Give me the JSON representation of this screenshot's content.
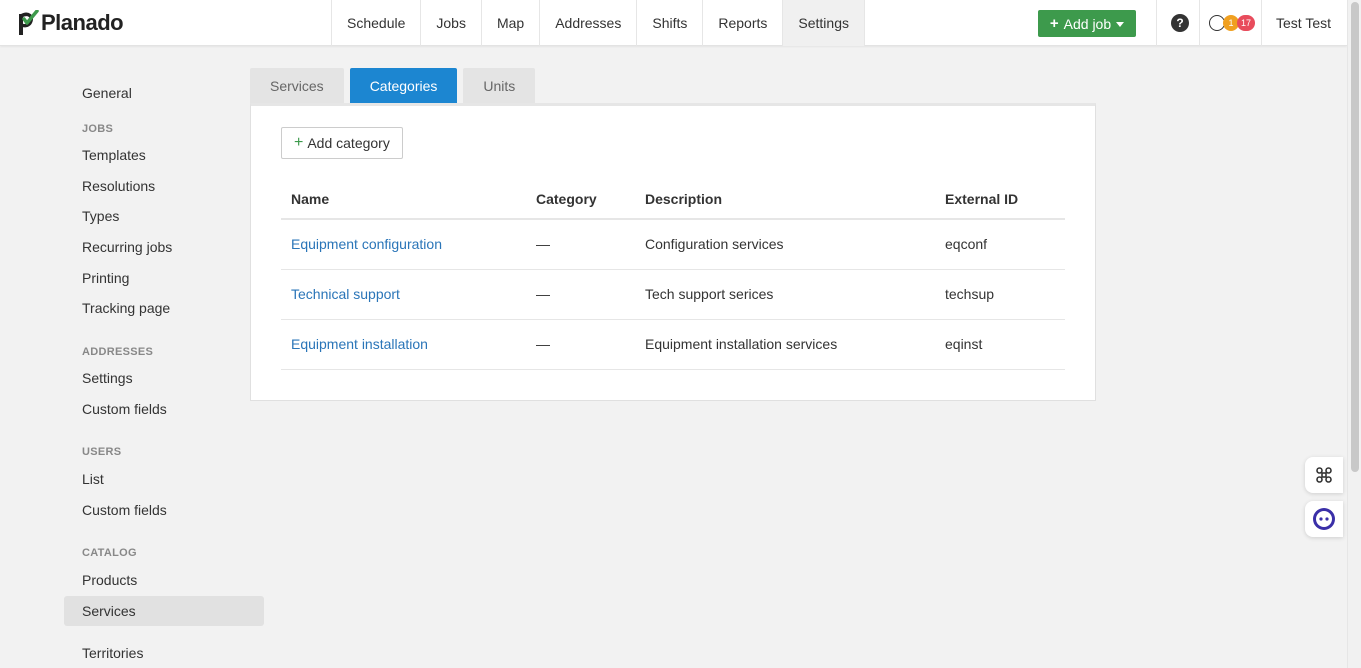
{
  "app": {
    "logo_text": "Planado",
    "brand_color": "#3d9a4c"
  },
  "nav": {
    "items": [
      "Schedule",
      "Jobs",
      "Map",
      "Addresses",
      "Shifts",
      "Reports",
      "Settings"
    ],
    "active": "Settings"
  },
  "header": {
    "add_job_label": "Add job",
    "help_label": "?",
    "notif_count_1": "1",
    "notif_count_2": "17",
    "user_name": "Test Test"
  },
  "sidebar": {
    "general": "General",
    "jobs_head": "JOBS",
    "templates": "Templates",
    "resolutions": "Resolutions",
    "types": "Types",
    "recurring_jobs": "Recurring jobs",
    "printing": "Printing",
    "tracking_page": "Tracking page",
    "addresses_head": "ADDRESSES",
    "addr_settings": "Settings",
    "addr_custom_fields": "Custom fields",
    "users_head": "USERS",
    "users_list": "List",
    "users_custom_fields": "Custom fields",
    "catalog_head": "CATALOG",
    "products": "Products",
    "services": "Services",
    "territories": "Territories"
  },
  "tabs": {
    "services": "Services",
    "categories": "Categories",
    "units": "Units",
    "active": "Categories"
  },
  "panel": {
    "add_category_label": "Add category",
    "columns": [
      "Name",
      "Category",
      "Description",
      "External ID"
    ],
    "rows": [
      {
        "name": "Equipment configuration",
        "category": "—",
        "description": "Configuration services",
        "external_id": "eqconf"
      },
      {
        "name": "Technical support",
        "category": "—",
        "description": "Tech support serices",
        "external_id": "techsup"
      },
      {
        "name": "Equipment installation",
        "category": "—",
        "description": "Equipment installation services",
        "external_id": "eqinst"
      }
    ]
  },
  "colors": {
    "accent": "#1c86d1",
    "link": "#2a75b8",
    "badge_orange": "#f0a020",
    "badge_red": "#e84c5c"
  }
}
